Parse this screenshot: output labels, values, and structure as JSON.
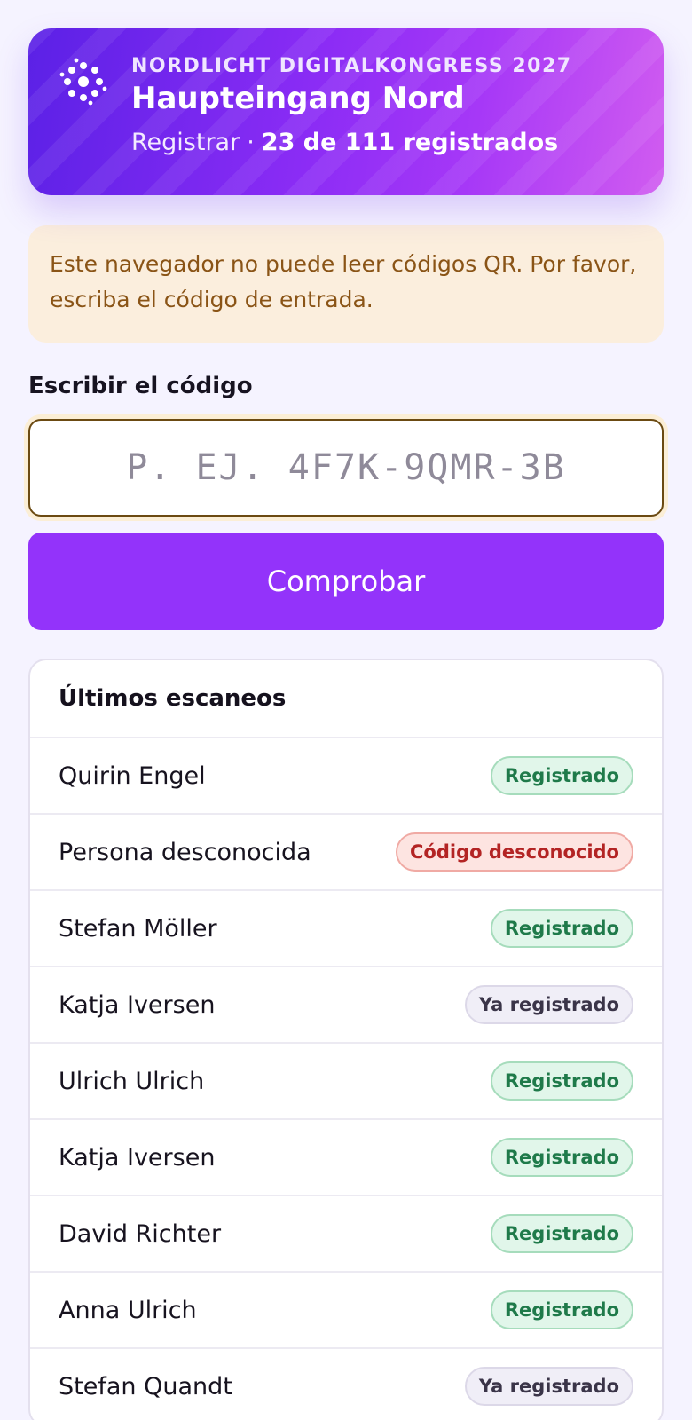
{
  "header": {
    "event": "NORDLICHT DIGITALKONGRESS 2027",
    "title": "Haupteingang Nord",
    "mode": "Registrar",
    "separator": "·",
    "count": "23 de 111 registrados",
    "logo_icon": "sparkle-dots-icon"
  },
  "warning": {
    "text": "Este navegador no puede leer códigos QR. Por favor, escriba el código de entrada."
  },
  "entry": {
    "label": "Escribir el código",
    "placeholder": "P. EJ. 4F7K-9QMR-3B",
    "value": "",
    "button_label": "Comprobar"
  },
  "recent": {
    "title": "Últimos escaneos",
    "rows": [
      {
        "name": "Quirin Engel",
        "status": "Registrado",
        "kind": "ok"
      },
      {
        "name": "Persona desconocida",
        "status": "Código desconocido",
        "kind": "err"
      },
      {
        "name": "Stefan Möller",
        "status": "Registrado",
        "kind": "ok"
      },
      {
        "name": "Katja Iversen",
        "status": "Ya registrado",
        "kind": "dup"
      },
      {
        "name": "Ulrich Ulrich",
        "status": "Registrado",
        "kind": "ok"
      },
      {
        "name": "Katja Iversen",
        "status": "Registrado",
        "kind": "ok"
      },
      {
        "name": "David Richter",
        "status": "Registrado",
        "kind": "ok"
      },
      {
        "name": "Anna Ulrich",
        "status": "Registrado",
        "kind": "ok"
      },
      {
        "name": "Stefan Quandt",
        "status": "Ya registrado",
        "kind": "dup"
      }
    ]
  },
  "colors": {
    "accent": "#9333fa",
    "warning_bg": "#fbeedd",
    "ok": "#1f7a4a",
    "err": "#b32424"
  }
}
